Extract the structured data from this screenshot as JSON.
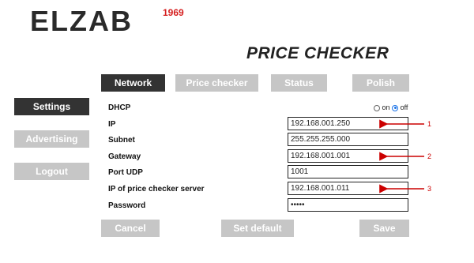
{
  "brand": {
    "logo_text": "ELZAB",
    "logo_year": "1969",
    "accent_color": "#d51f1f"
  },
  "page_title": "PRICE CHECKER",
  "tabs": [
    {
      "label": "Network",
      "active": true
    },
    {
      "label": "Price checker",
      "active": false
    },
    {
      "label": "Status",
      "active": false
    },
    {
      "label": "Polish",
      "active": false
    }
  ],
  "sidebar": [
    {
      "label": "Settings",
      "active": true
    },
    {
      "label": "Advertising",
      "active": false
    },
    {
      "label": "Logout",
      "active": false
    }
  ],
  "form": {
    "dhcp": {
      "label": "DHCP",
      "on_label": "on",
      "off_label": "off",
      "selected": "off"
    },
    "ip": {
      "label": "IP",
      "value": "192.168.001.250"
    },
    "subnet": {
      "label": "Subnet",
      "value": "255.255.255.000"
    },
    "gateway": {
      "label": "Gateway",
      "value": "192.168.001.001"
    },
    "port_udp": {
      "label": "Port UDP",
      "value": "1001"
    },
    "server_ip": {
      "label": "IP of price checker server",
      "value": "192.168.001.011"
    },
    "password": {
      "label": "Password",
      "value": "•••••"
    }
  },
  "buttons": {
    "cancel": "Cancel",
    "set_default": "Set default",
    "save": "Save"
  },
  "annotations": [
    "1",
    "2",
    "3"
  ],
  "colors": {
    "active_tab": "#333333",
    "inactive_tab": "#c6c6c6",
    "annotation": "#cc0000",
    "radio_selected": "#1a73e8"
  }
}
